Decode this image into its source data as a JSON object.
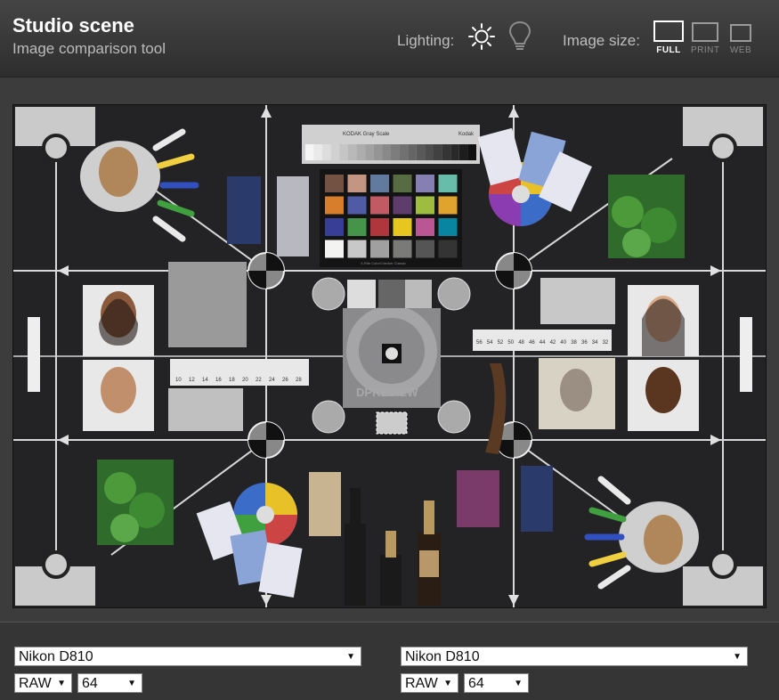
{
  "header": {
    "title": "Studio scene",
    "subtitle": "Image comparison tool",
    "lighting_label": "Lighting:",
    "lighting_options": [
      {
        "icon": "sun-icon",
        "active": true
      },
      {
        "icon": "bulb-icon",
        "active": false
      }
    ],
    "image_size_label": "Image size:",
    "size_options": [
      {
        "label": "FULL",
        "active": true
      },
      {
        "label": "PRINT",
        "active": false
      },
      {
        "label": "WEB",
        "active": false
      }
    ]
  },
  "scene": {
    "gray_scale_label": "KODAK Gray Scale",
    "kodak_label": "Kodak",
    "color_checker_caption": "X-Rite ColorChecker Classic",
    "logo_text": "DPREVIEW",
    "ruler_top": [
      "56",
      "54",
      "52",
      "50",
      "48",
      "46",
      "44",
      "42",
      "40",
      "38",
      "36",
      "34",
      "32"
    ],
    "ruler_left": [
      "10",
      "12",
      "14",
      "16",
      "18",
      "20",
      "22",
      "24",
      "26",
      "28"
    ],
    "swatch_colors": [
      "#735244",
      "#c29682",
      "#627a9d",
      "#576c43",
      "#8580b1",
      "#67bdaa",
      "#d67e2c",
      "#505ba6",
      "#c15a63",
      "#5e3c6c",
      "#9dbc40",
      "#e0a32e",
      "#383d96",
      "#469449",
      "#af363c",
      "#e7c71f",
      "#bb5695",
      "#0885a1",
      "#f3f3f2",
      "#c8c8c8",
      "#a0a0a0",
      "#7a7a79",
      "#555555",
      "#343434"
    ],
    "accent_colors": {
      "background": "#232325",
      "frame": "#3c3c3c",
      "white": "#ffffff"
    }
  },
  "comparison": {
    "left": {
      "camera": "Nikon D810",
      "format": "RAW",
      "iso": "64"
    },
    "right": {
      "camera": "Nikon D810",
      "format": "RAW",
      "iso": "64"
    }
  }
}
